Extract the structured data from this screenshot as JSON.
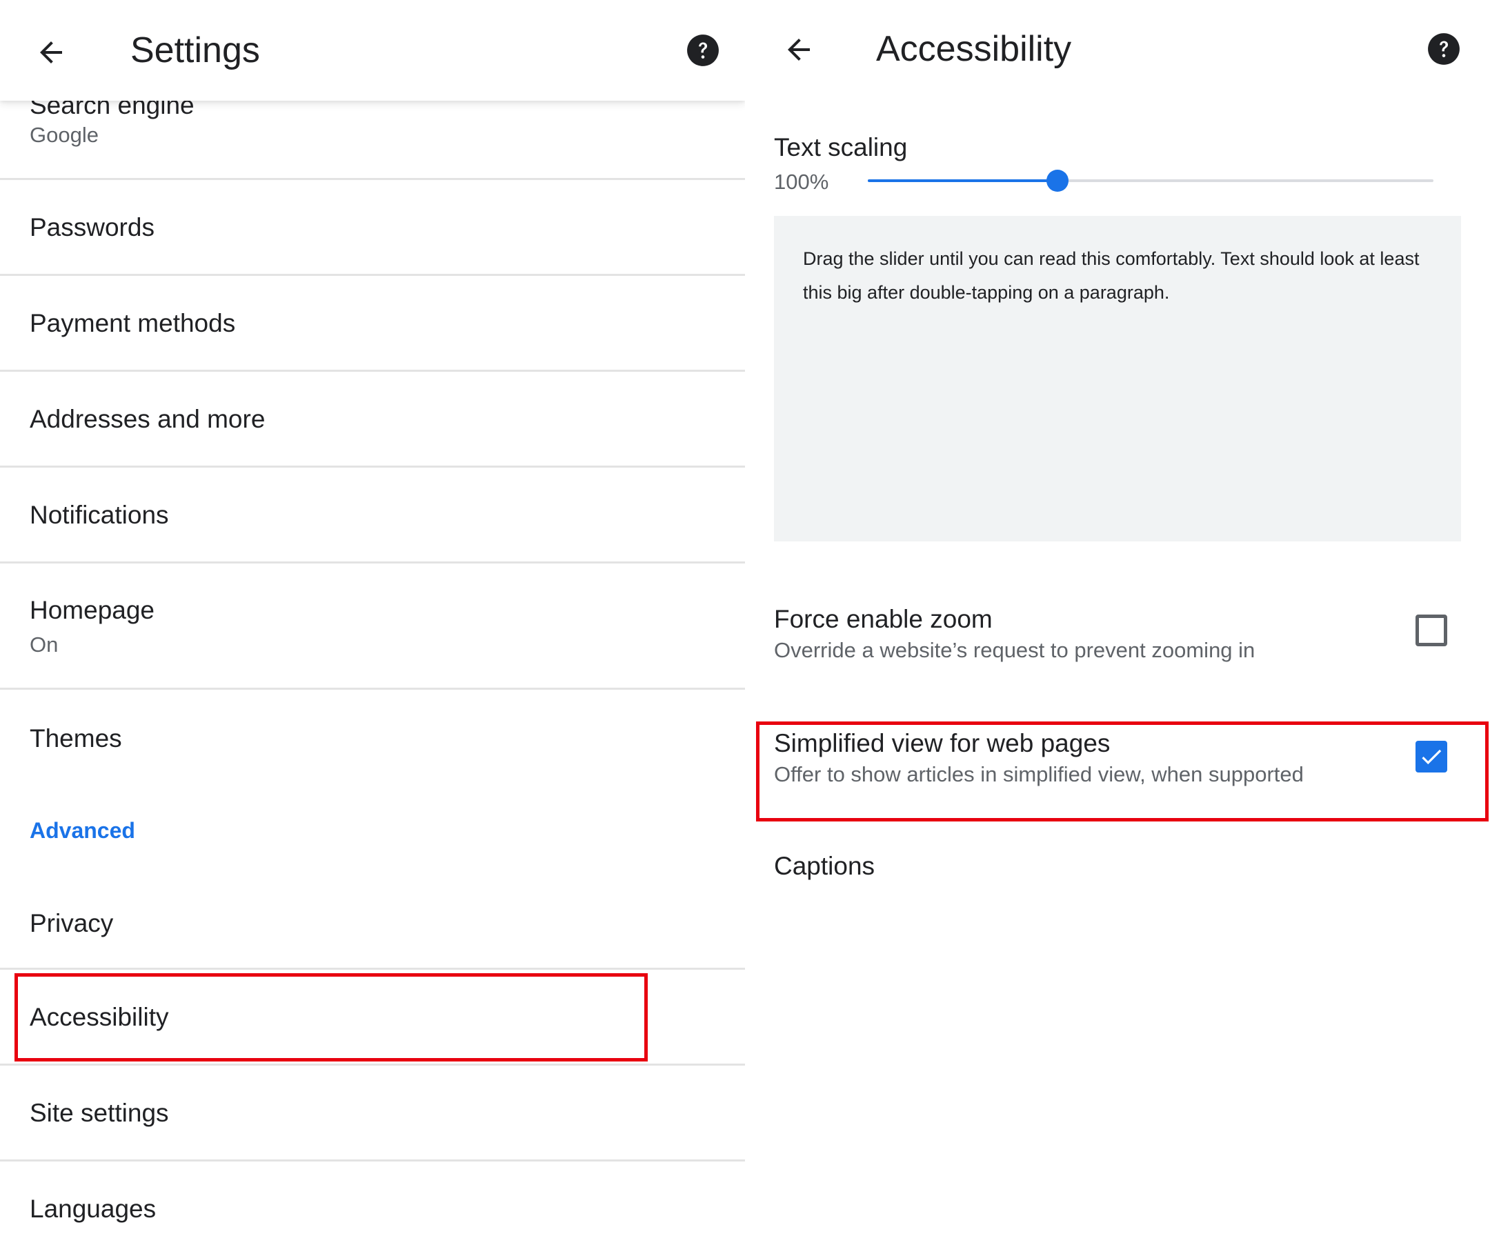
{
  "settings_panel": {
    "title": "Settings",
    "back_icon": "arrow-back-icon",
    "help_icon": "help-icon",
    "items": [
      {
        "label": "Search engine",
        "sublabel": "Google"
      },
      {
        "label": "Passwords"
      },
      {
        "label": "Payment methods"
      },
      {
        "label": "Addresses and more"
      },
      {
        "label": "Notifications"
      },
      {
        "label": "Homepage",
        "sublabel": "On"
      },
      {
        "label": "Themes"
      },
      {
        "label": "Privacy"
      },
      {
        "label": "Accessibility"
      },
      {
        "label": "Site settings"
      },
      {
        "label": "Languages"
      }
    ],
    "advanced_header": "Advanced",
    "accent_color": "#1a73e8",
    "highlight_color": "#e8000f"
  },
  "accessibility_panel": {
    "title": "Accessibility",
    "back_icon": "arrow-back-icon",
    "help_icon": "help-icon",
    "text_scaling": {
      "label": "Text scaling",
      "value_text": "100%",
      "slider_fraction": 0.335
    },
    "preview_text": "Drag the slider until you can read this comfortably. Text should look at least this big after double-tapping on a paragraph.",
    "force_zoom": {
      "label": "Force enable zoom",
      "description": "Override a website’s request to prevent zooming in",
      "checked": false
    },
    "simplified_view": {
      "label": "Simplified view for web pages",
      "description": "Offer to show articles in simplified view, when supported",
      "checked": true
    },
    "captions": {
      "label": "Captions"
    }
  }
}
